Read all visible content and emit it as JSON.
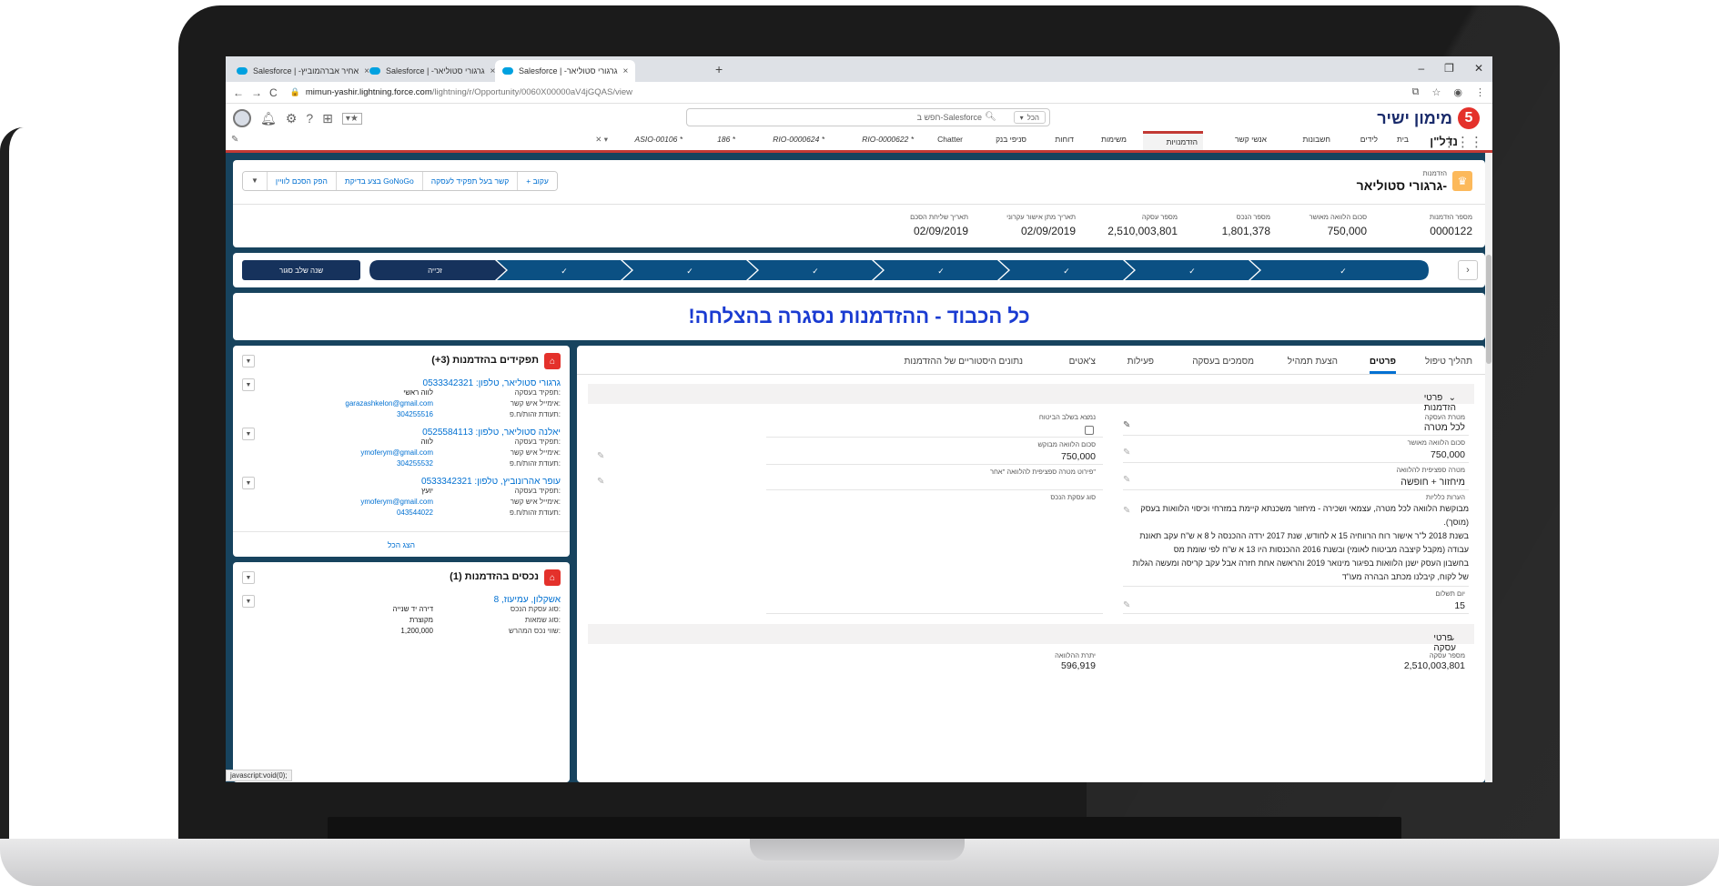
{
  "browser": {
    "tabs": [
      {
        "label": "Salesforce | -אחיר אברהמוביץ"
      },
      {
        "label": "Salesforce | -גרגורי סטוליאר"
      },
      {
        "label": "Salesforce | -גרגורי סטוליאר"
      }
    ],
    "url_host": "mimun-yashir.lightning.force.com",
    "url_path": "/lightning/r/Opportunity/0060X00000aV4jGQAS/view"
  },
  "sf": {
    "logo_text": "מימון ישיר",
    "logo_num": "5",
    "search_placeholder": "חפש ב-Salesforce",
    "search_scope": "הכל",
    "app_name": "נדל\"ן",
    "nav": [
      "בית",
      "לידים",
      "חשבונות",
      "אנשי קשר",
      "הזדמנויות",
      "משימות",
      "דוחות",
      "סניפי בנק",
      "Chatter",
      "RIO-0000622 *",
      "RIO-0000624 *",
      "186 *",
      "ASIO-00106 *"
    ]
  },
  "record": {
    "type": "הזדמנות",
    "title": "גרגורי סטוליאר-",
    "actions": [
      "+ עקוב",
      "קשר בעל תפקיד לעסקה",
      "בצע בדיקת GoNoGo",
      "הפק הסכם לוויין"
    ],
    "highlights": [
      {
        "label": "מספר הזדמנות",
        "value": "0000122"
      },
      {
        "label": "סכום הלוואה מאושר",
        "value": "750,000"
      },
      {
        "label": "מספר הנכס",
        "value": "1,801,378"
      },
      {
        "label": "מספר עסקה",
        "value": "2,510,003,801"
      },
      {
        "label": "תאריך מתן אישור עקרוני",
        "value": "02/09/2019"
      },
      {
        "label": "תאריך שליחת הסכם",
        "value": "02/09/2019"
      }
    ]
  },
  "path": {
    "button_label": "שנה שלב סגור",
    "current_label": "זכייה",
    "done_mark": "✓"
  },
  "banner": {
    "text": "!כל הכבוד - ההזדמנות נסגרה בהצלחה"
  },
  "tabs": [
    "תהליך טיפול",
    "פרטים",
    "הצעת תמהיל",
    "מסמכים בעסקה",
    "פעילות",
    "צ'אטים",
    "נתונים היסטוריים של ההזדמנות"
  ],
  "details": {
    "section1": "פרטי הזדמנות",
    "section2": "פרטי עסקה",
    "fields": {
      "loan_purpose_label": "מטרת העסקה",
      "loan_purpose_value": "לכל מטרה",
      "approved_label": "סכום הלוואה מאושר",
      "approved_value": "750,000",
      "loan_details_label": "מטרה ספציפית להלוואה",
      "loan_details_value": "מיחזור + חופשה",
      "notes_label": "הערות כלליות",
      "notes_lines": [
        "מבוקשת הלוואה לכל מטרה, עצמאי ושכירה - מיחזור משכנתא קיימת במזרחי וכיסוי הלוואות בעסק",
        "(מוסך).",
        "בשנת 2018 ל\"ר אישור רוח הרווחיה 15 א לחודש, שנת 2017 ירדה ההכנסה ל 8 א ש\"ח עקב תאונת",
        "עבודה (מקבל קיצבה מביטוח לאומי) ובשנת 2016 ההכנסות היו 13 א ש\"ח לפי שומת מס",
        "בחשבון העסק ישנן הלוואות בפיגור מינואר 2019 והראשה אחת חזרה אבל עקב קריסה ומעשה הגלות",
        "של לקוח, קיבלנו מכתב הבהרה מעו\"ד"
      ],
      "payday_label": "יום תשלום",
      "payday_value": "15",
      "prev_stage_label": "נמצא בשלב הביטוח",
      "requested_label": "סכום הלוואה מבוקש",
      "requested_value": "750,000",
      "specific_other_label": "פירוט מטרה ספציפית להלוואה \"אחר\"",
      "property_type_label": "סוג עסקת הנכס",
      "deal_number_label": "מספר עסקה",
      "deal_number_value": "2,510,003,801",
      "balance_label": "יתרת ההלוואה",
      "balance_value": "596,919"
    }
  },
  "roles_card": {
    "title": "תפקידים בהזדמנות (3+)",
    "contacts": [
      {
        "name": "גרגורי סטוליאר, טלפון: 0533342321",
        "role_k": "תפקיד בעסקה:",
        "role_v": "לווה ראשי",
        "email_k": "אימייל איש קשר:",
        "email_v": "garazashkelon@gmail.com",
        "id_k": "תעודת זהות/ח.פ:",
        "id_v": "304255516"
      },
      {
        "name": "יאלנה סטוליאר, טלפון: 0525584113",
        "role_k": "תפקיד בעסקה:",
        "role_v": "לווה",
        "email_k": "אימייל איש קשר:",
        "email_v": "ymoferym@gmail.com",
        "id_k": "תעודת זהות/ח.פ:",
        "id_v": "304255532"
      },
      {
        "name": "עופר אהרונוביץ, טלפון: 0533342321",
        "role_k": "תפקיד בעסקה:",
        "role_v": "יועץ",
        "email_k": "אימייל איש קשר:",
        "email_v": "ymoferym@gmail.com",
        "id_k": "תעודת זהות/ח.פ:",
        "id_v": "043544022"
      }
    ],
    "view_all": "הצג הכל"
  },
  "assets_card": {
    "title": "נכסים בהזדמנות (1)",
    "asset_name": "אשקלון, עמיעוז, 8",
    "rows": [
      {
        "k": "סוג עסקת הנכס:",
        "v": "דירה יד שנייה"
      },
      {
        "k": "סוג שמאות:",
        "v": "מקוצרת"
      },
      {
        "k": "שווי נכס המהרש:",
        "v": "1,200,000"
      }
    ]
  },
  "statusbar": "javascript:void(0);",
  "colors": {
    "brand_red": "#c23934",
    "path_blue": "#0b5083",
    "path_dark": "#16325c",
    "banner_blue": "#1a3bd1",
    "page_bg": "#17435e"
  }
}
